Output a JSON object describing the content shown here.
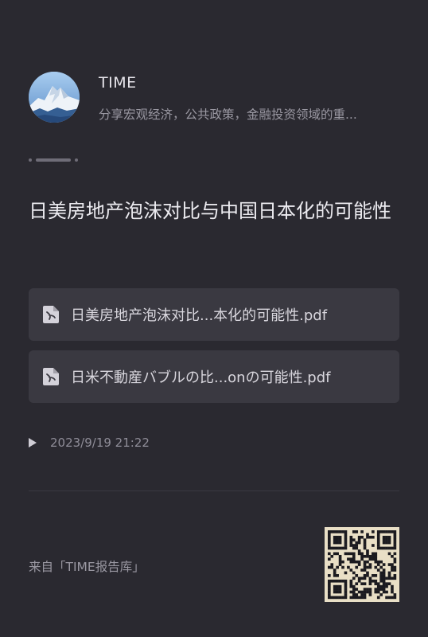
{
  "channel": {
    "name": "TIME",
    "description": "分享宏观经济，公共政策，金融投资领域的重..."
  },
  "post": {
    "title": "日美房地产泡沫对比与中国日本化的可能性",
    "files": [
      {
        "name": "日美房地产泡沫对比...本化的可能性.pdf",
        "icon": "pdf-file-icon"
      },
      {
        "name": "日米不動産バブルの比...onの可能性.pdf",
        "icon": "pdf-file-icon"
      }
    ],
    "timestamp": "2023/9/19 21:22"
  },
  "footer": {
    "source": "来自「TIME报告库」"
  },
  "colors": {
    "background": "#2a2930",
    "card": "#3a3941",
    "qr_background": "#e9dfc6"
  }
}
